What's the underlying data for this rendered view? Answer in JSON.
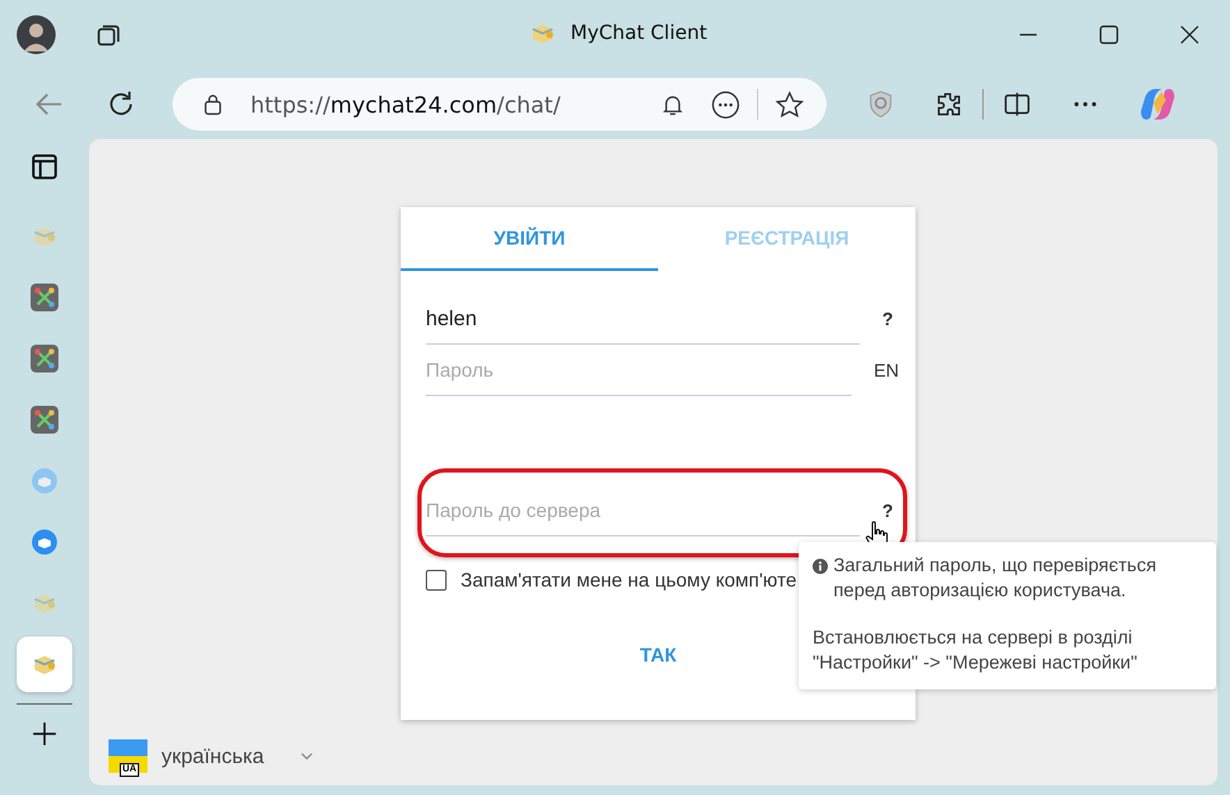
{
  "window": {
    "title": "MyChat Client"
  },
  "address_bar": {
    "url_host": "mychat24.com",
    "url_scheme": "https://",
    "url_path": "/chat/"
  },
  "sidebar": {
    "items": [
      {
        "kind": "cube",
        "selected": false
      },
      {
        "kind": "network",
        "selected": false
      },
      {
        "kind": "network",
        "selected": false
      },
      {
        "kind": "network",
        "selected": false
      },
      {
        "kind": "bubble-light",
        "selected": false
      },
      {
        "kind": "bubble",
        "selected": false
      },
      {
        "kind": "cube",
        "selected": false
      },
      {
        "kind": "cube",
        "selected": true
      }
    ]
  },
  "login": {
    "tabs": [
      {
        "label": "УВІЙТИ",
        "selected": true
      },
      {
        "label": "РЕЄСТРАЦІЯ",
        "selected": false
      }
    ],
    "fields": [
      {
        "kind": "text",
        "value": "helen",
        "suffix": "?",
        "highlighted": false
      },
      {
        "kind": "password",
        "placeholder": "Пароль",
        "suffix": "EN",
        "highlighted": false
      },
      {
        "kind": "password",
        "placeholder": "Пароль до сервера",
        "suffix": "?",
        "highlighted": true
      }
    ],
    "remember": {
      "label": "Запам'ятати мене на цьому комп'юте",
      "checked": false
    },
    "submit": "ТАК"
  },
  "tooltip": {
    "lines": [
      "Загальний пароль, що перевіряється перед авторизацією користувача.",
      "Встановлюється на сервері в розділі \"Настройки\" -> \"Мережеві настройки\""
    ]
  },
  "language": {
    "label": "українська",
    "flag_code": "UA"
  }
}
